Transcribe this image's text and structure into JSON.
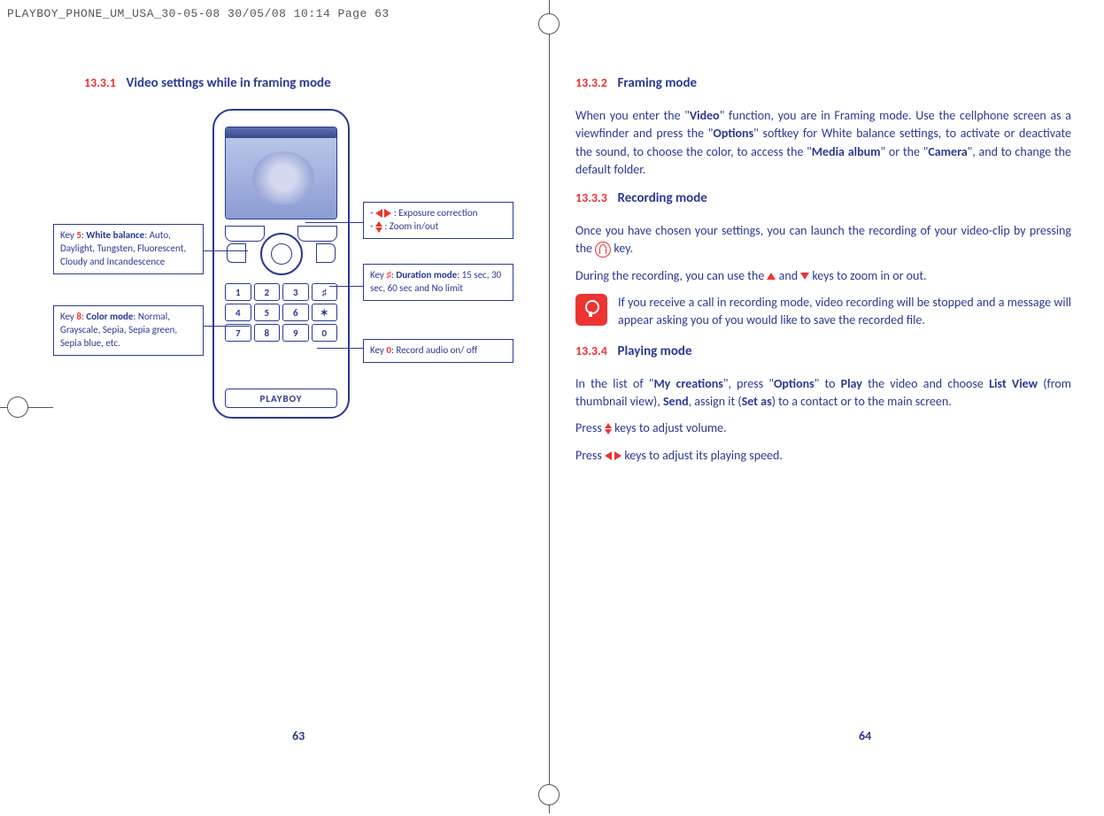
{
  "print_header": "PLAYBOY_PHONE_UM_USA_30-05-08  30/05/08  10:14  Page 63",
  "left": {
    "sec_num": "13.3.1",
    "sec_title": "Video settings while in framing mode",
    "brand": "PLAYBOY",
    "callouts": {
      "wb_pre": "Key ",
      "wb_key": "5",
      "wb_mid": ": ",
      "wb_bold": "White balance",
      "wb_post": ": Auto, Daylight, Tungsten, Fluorescent, Cloudy and Incandescence",
      "cm_pre": "Key ",
      "cm_key": "8",
      "cm_mid": ": ",
      "cm_bold": "Color mode",
      "cm_post": ": Normal, Grayscale, Sepia, Sepia green, Sepia blue, etc.",
      "ez_l1_pre": "- ",
      "ez_l1_post": " : Exposure correction",
      "ez_l2_pre": "- ",
      "ez_l2_post": " : Zoom in/out",
      "dm_pre": "Key ",
      "dm_key": "♯",
      "dm_mid": ": ",
      "dm_bold": "Duration mode",
      "dm_post": ": 15 sec, 30 sec, 60 sec and No limit",
      "ra_pre": "Key ",
      "ra_key": "0",
      "ra_post": ": Record audio on/ off"
    },
    "keypad": [
      "1",
      "2",
      "3",
      "♯",
      "4",
      "5",
      "6",
      "✶",
      "7",
      "8",
      "9",
      "0"
    ],
    "pagenum": "63"
  },
  "right": {
    "s1_num": "13.3.2",
    "s1_title": "Framing mode",
    "s1_p1a": "When you enter the \"",
    "s1_p1b": "Video",
    "s1_p1c": "\" function, you are in Framing mode.  Use the cellphone screen as a viewfinder and press the \"",
    "s1_p1d": "Options",
    "s1_p1e": "\" softkey for White balance settings,  to activate or deactivate the sound,  to choose the color,  to access the \"",
    "s1_p1f": "Media album",
    "s1_p1g": "\" or the \"",
    "s1_p1h": "Camera",
    "s1_p1i": "\",  and to change the default folder.",
    "s2_num": "13.3.3",
    "s2_title": "Recording mode",
    "s2_p1": "Once you have chosen your settings, you can launch the recording of your video-clip by pressing the ",
    "s2_p1b": " key.",
    "s2_p2a": "During the recording,  you can use the ",
    "s2_p2b": " and ",
    "s2_p2c": " keys to zoom in or out.",
    "tip": "If you receive a call in recording mode, video recording will be stopped and a message will appear asking you of you would like to save the recorded file.",
    "s3_num": "13.3.4",
    "s3_title": "Playing mode",
    "s3_p1a": "In the list of \"",
    "s3_p1b": "My creations",
    "s3_p1c": "\", press \"",
    "s3_p1d": "Options",
    "s3_p1e": "\" to ",
    "s3_p1f": "Play",
    "s3_p1g": " the video and choose ",
    "s3_p1h": "List View",
    "s3_p1i": " (from thumbnail view), ",
    "s3_p1j": "Send",
    "s3_p1k": ", assign it (",
    "s3_p1l": "Set as",
    "s3_p1m": ") to a contact or to the main screen.",
    "s3_p2a": "Press ",
    "s3_p2b": " keys to adjust volume.",
    "s3_p3a": "Press ",
    "s3_p3b": " keys to adjust its playing speed.",
    "pagenum": "64"
  }
}
